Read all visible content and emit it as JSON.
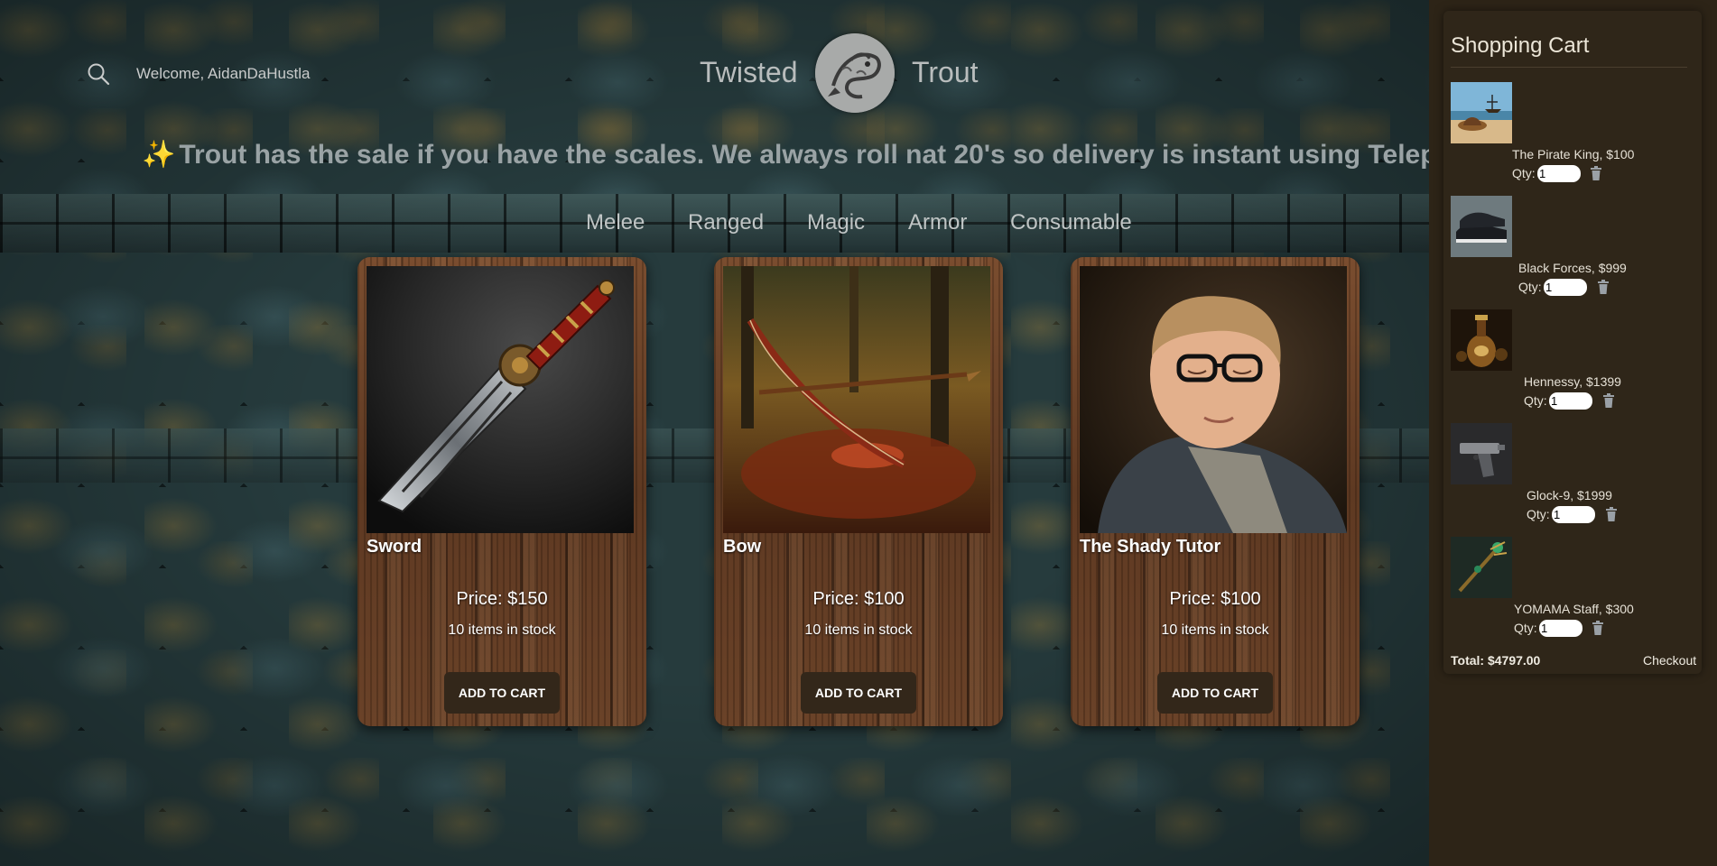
{
  "header": {
    "welcome": "Welcome, AidanDaHustla",
    "brand_left": "Twisted",
    "brand_right": "Trout",
    "search_icon": "search-icon",
    "logo_icon": "trout-logo"
  },
  "announcement": {
    "sparkle": "✨",
    "text": "Trout has the sale if you have the scales. We always roll nat 20's so delivery is instant using Telep"
  },
  "nav": {
    "items": [
      "Melee",
      "Ranged",
      "Magic",
      "Armor",
      "Consumable"
    ]
  },
  "products": [
    {
      "title": "Sword",
      "price": "Price: $150",
      "stock": "10 items in stock",
      "button": "ADD TO CART"
    },
    {
      "title": "Bow",
      "price": "Price: $100",
      "stock": "10 items in stock",
      "button": "ADD TO CART"
    },
    {
      "title": "The Shady Tutor",
      "price": "Price: $100",
      "stock": "10 items in stock",
      "button": "ADD TO CART"
    }
  ],
  "cart": {
    "title": "Shopping Cart",
    "qty_label": "Qty:",
    "items": [
      {
        "name": "The Pirate King, $100",
        "qty": "1"
      },
      {
        "name": "Black Forces, $999",
        "qty": "1"
      },
      {
        "name": "Hennessy, $1399",
        "qty": "1"
      },
      {
        "name": "Glock-9, $1999",
        "qty": "1"
      },
      {
        "name": "YOMAMA Staff, $300",
        "qty": "1"
      }
    ],
    "total": "Total: $4797.00",
    "checkout": "Checkout",
    "trash_icon": "trash-icon"
  },
  "colors": {
    "cart_background": "#2d2417",
    "button_background": "#33271a",
    "wall_base": "#263b3d"
  }
}
